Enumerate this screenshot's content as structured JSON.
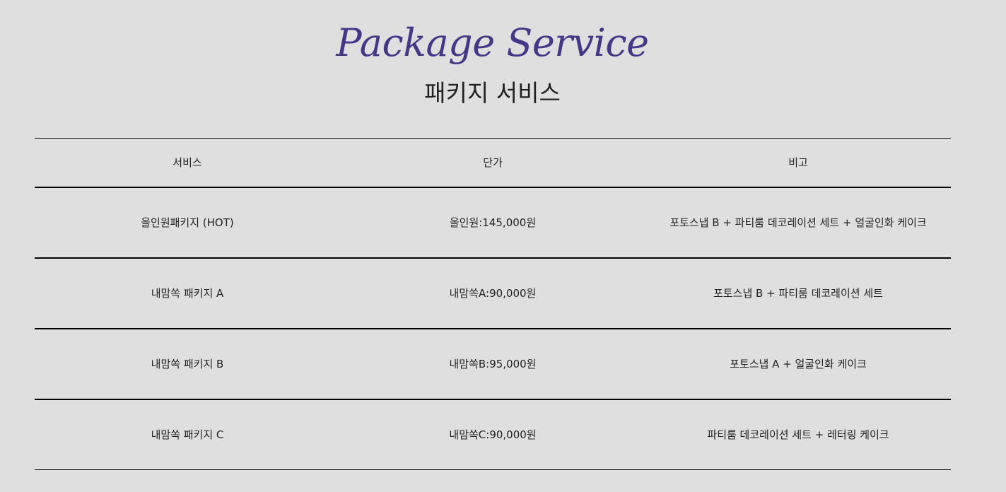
{
  "heading": {
    "script_title": "Package Service",
    "sub_title": "패키지 서비스"
  },
  "table": {
    "columns": [
      "서비스",
      "단가",
      "비고"
    ],
    "rows": [
      [
        "올인원패키지 (HOT)",
        "올인원:145,000원",
        "포토스냅 B + 파티룸 데코레이션 세트 + 얼굴인화 케이크"
      ],
      [
        "내맘쏙 패키지 A",
        "내맘쏙A:90,000원",
        "포토스냅 B + 파티룸 데코레이션 세트"
      ],
      [
        "내맘쏙 패키지 B",
        "내맘쏙B:95,000원",
        "포토스냅 A + 얼굴인화 케이크"
      ],
      [
        "내맘쏙 패키지 C",
        "내맘쏙C:90,000원",
        "파티룸 데코레이션 세트 + 레터링 케이크"
      ]
    ]
  },
  "colors": {
    "background": "#dfdfdf",
    "accent": "#453787",
    "text": "#222222",
    "rule": "#000000"
  }
}
